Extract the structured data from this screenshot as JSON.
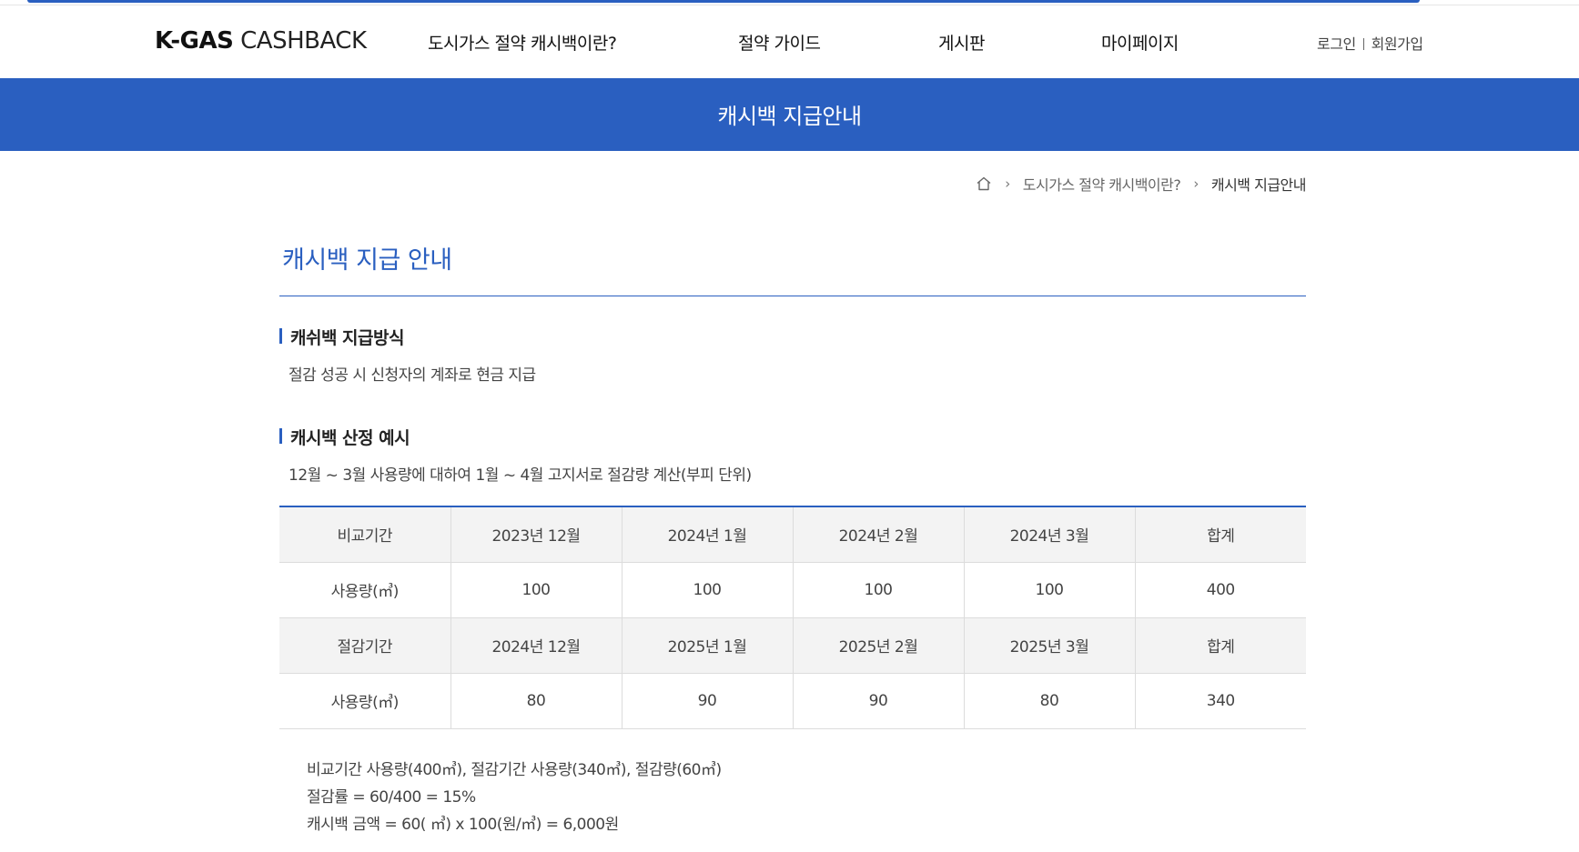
{
  "header": {
    "logo_bold": "K-GAS",
    "logo_light": "CASHBACK",
    "nav": [
      {
        "label": "도시가스 절약 캐시백이란?"
      },
      {
        "label": "절약 가이드"
      },
      {
        "label": "게시판"
      },
      {
        "label": "마이페이지"
      }
    ],
    "login": "로그인",
    "signup": "회원가입"
  },
  "banner": {
    "title": "캐시백 지급안내"
  },
  "breadcrumb": {
    "home_icon": "home-icon",
    "items": [
      "도시가스 절약 캐시백이란?",
      "캐시백 지급안내"
    ]
  },
  "main": {
    "title": "캐시백 지급 안내",
    "section1": {
      "heading": "캐쉬백 지급방식",
      "text": "절감 성공 시 신청자의 계좌로 현금 지급"
    },
    "section2": {
      "heading": "캐시백 산정 예시",
      "text": "12월 ~ 3월 사용량에 대하여 1월 ~ 4월 고지서로 절감량 계산(부피 단위)"
    },
    "table": {
      "rows": [
        [
          "비교기간",
          "2023년 12월",
          "2024년 1월",
          "2024년 2월",
          "2024년 3월",
          "합계"
        ],
        [
          "사용량(㎥)",
          "100",
          "100",
          "100",
          "100",
          "400"
        ],
        [
          "절감기간",
          "2024년 12월",
          "2025년 1월",
          "2025년 2월",
          "2025년 3월",
          "합계"
        ],
        [
          "사용량(㎥)",
          "80",
          "90",
          "90",
          "80",
          "340"
        ]
      ]
    },
    "notes": [
      "비교기간 사용량(400㎥), 절감기간 사용량(340㎥), 절감량(60㎥)",
      "절감률 = 60/400 = 15%",
      "캐시백 금액 = 60( ㎥) x 100(원/㎥) = 6,000원"
    ]
  },
  "colors": {
    "brand_blue": "#2a5fc0",
    "table_shade": "#f3f3f3"
  }
}
